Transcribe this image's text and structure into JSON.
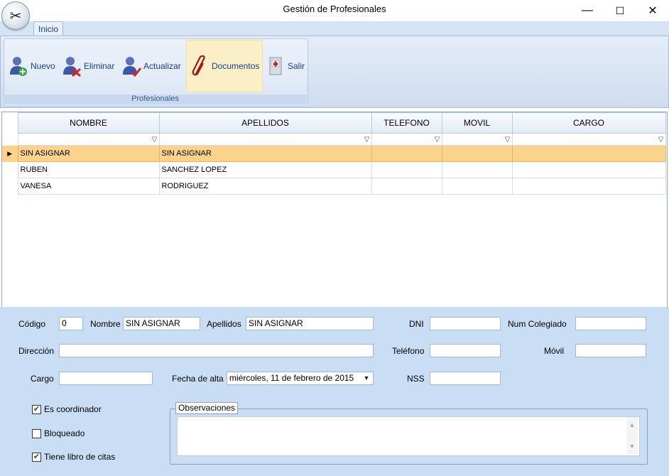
{
  "window": {
    "title": "Gestión de Profesionales",
    "minimize_glyph": "—",
    "maximize_glyph": "☐",
    "close_glyph": "✕",
    "orb_glyph": "✂"
  },
  "ribbon": {
    "tabs": [
      {
        "label": "Inicio",
        "active": true
      }
    ],
    "group_label": "Profesionales",
    "buttons": [
      {
        "label": "Nuevo",
        "icon": "user-add-icon"
      },
      {
        "label": "Eliminar",
        "icon": "user-delete-icon"
      },
      {
        "label": "Actualizar",
        "icon": "user-update-icon"
      },
      {
        "label": "Documentos",
        "icon": "paperclip-icon",
        "active": true
      },
      {
        "label": "Salir",
        "icon": "exit-door-icon"
      }
    ]
  },
  "grid": {
    "columns": [
      "NOMBRE",
      "APELLIDOS",
      "TELEFONO",
      "MOVIL",
      "CARGO"
    ],
    "filter_glyph": "▽",
    "selected_marker": "▶",
    "rows": [
      {
        "nombre": "SIN ASIGNAR",
        "apellidos": "SIN ASIGNAR",
        "telefono": "",
        "movil": "",
        "cargo": "",
        "selected": true
      },
      {
        "nombre": "RUBEN",
        "apellidos": "SANCHEZ LOPEZ",
        "telefono": "",
        "movil": "",
        "cargo": "",
        "selected": false
      },
      {
        "nombre": "VANESA",
        "apellidos": "RODRIGUEZ",
        "telefono": "",
        "movil": "",
        "cargo": "",
        "selected": false
      }
    ]
  },
  "form": {
    "codigo_label": "Código",
    "codigo_value": "0",
    "nombre_label": "Nombre",
    "nombre_value": "SIN ASIGNAR",
    "apellidos_label": "Apellidos",
    "apellidos_value": "SIN ASIGNAR",
    "dni_label": "DNI",
    "dni_value": "",
    "num_colegiado_label": "Num Colegiado",
    "num_colegiado_value": "",
    "direccion_label": "Dirección",
    "direccion_value": "",
    "telefono_label": "Teléfono",
    "telefono_value": "",
    "movil_label": "Móvil",
    "movil_value": "",
    "cargo_label": "Cargo",
    "cargo_value": "",
    "fecha_alta_label": "Fecha de alta",
    "fecha_alta_value": "miércoles, 11 de febrero de 2015",
    "nss_label": "NSS",
    "nss_value": "",
    "es_coordinador_label": "Es coordinador",
    "es_coordinador_checked": true,
    "bloqueado_label": "Bloqueado",
    "bloqueado_checked": false,
    "tiene_libro_label": "Tiene libro de citas",
    "tiene_libro_checked": true,
    "observaciones_label": "Observaciones",
    "observaciones_value": "",
    "check_glyph": "✔",
    "dropdown_glyph": "▼",
    "scroll_up_glyph": "▲",
    "scroll_down_glyph": "▼"
  },
  "colors": {
    "selected_row": "#fbd38a",
    "form_background": "#c9ddf5",
    "ribbon_text": "#15428b"
  }
}
